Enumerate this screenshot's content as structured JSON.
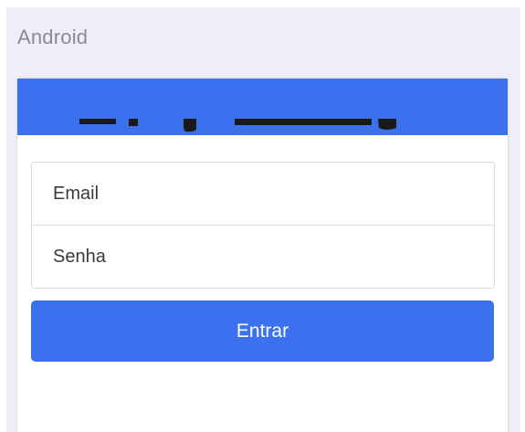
{
  "platform": {
    "label": "Android"
  },
  "login_form": {
    "header_color": "#3b70ee",
    "email": {
      "placeholder": "Email"
    },
    "password": {
      "placeholder": "Senha"
    },
    "submit_label": "Entrar"
  }
}
